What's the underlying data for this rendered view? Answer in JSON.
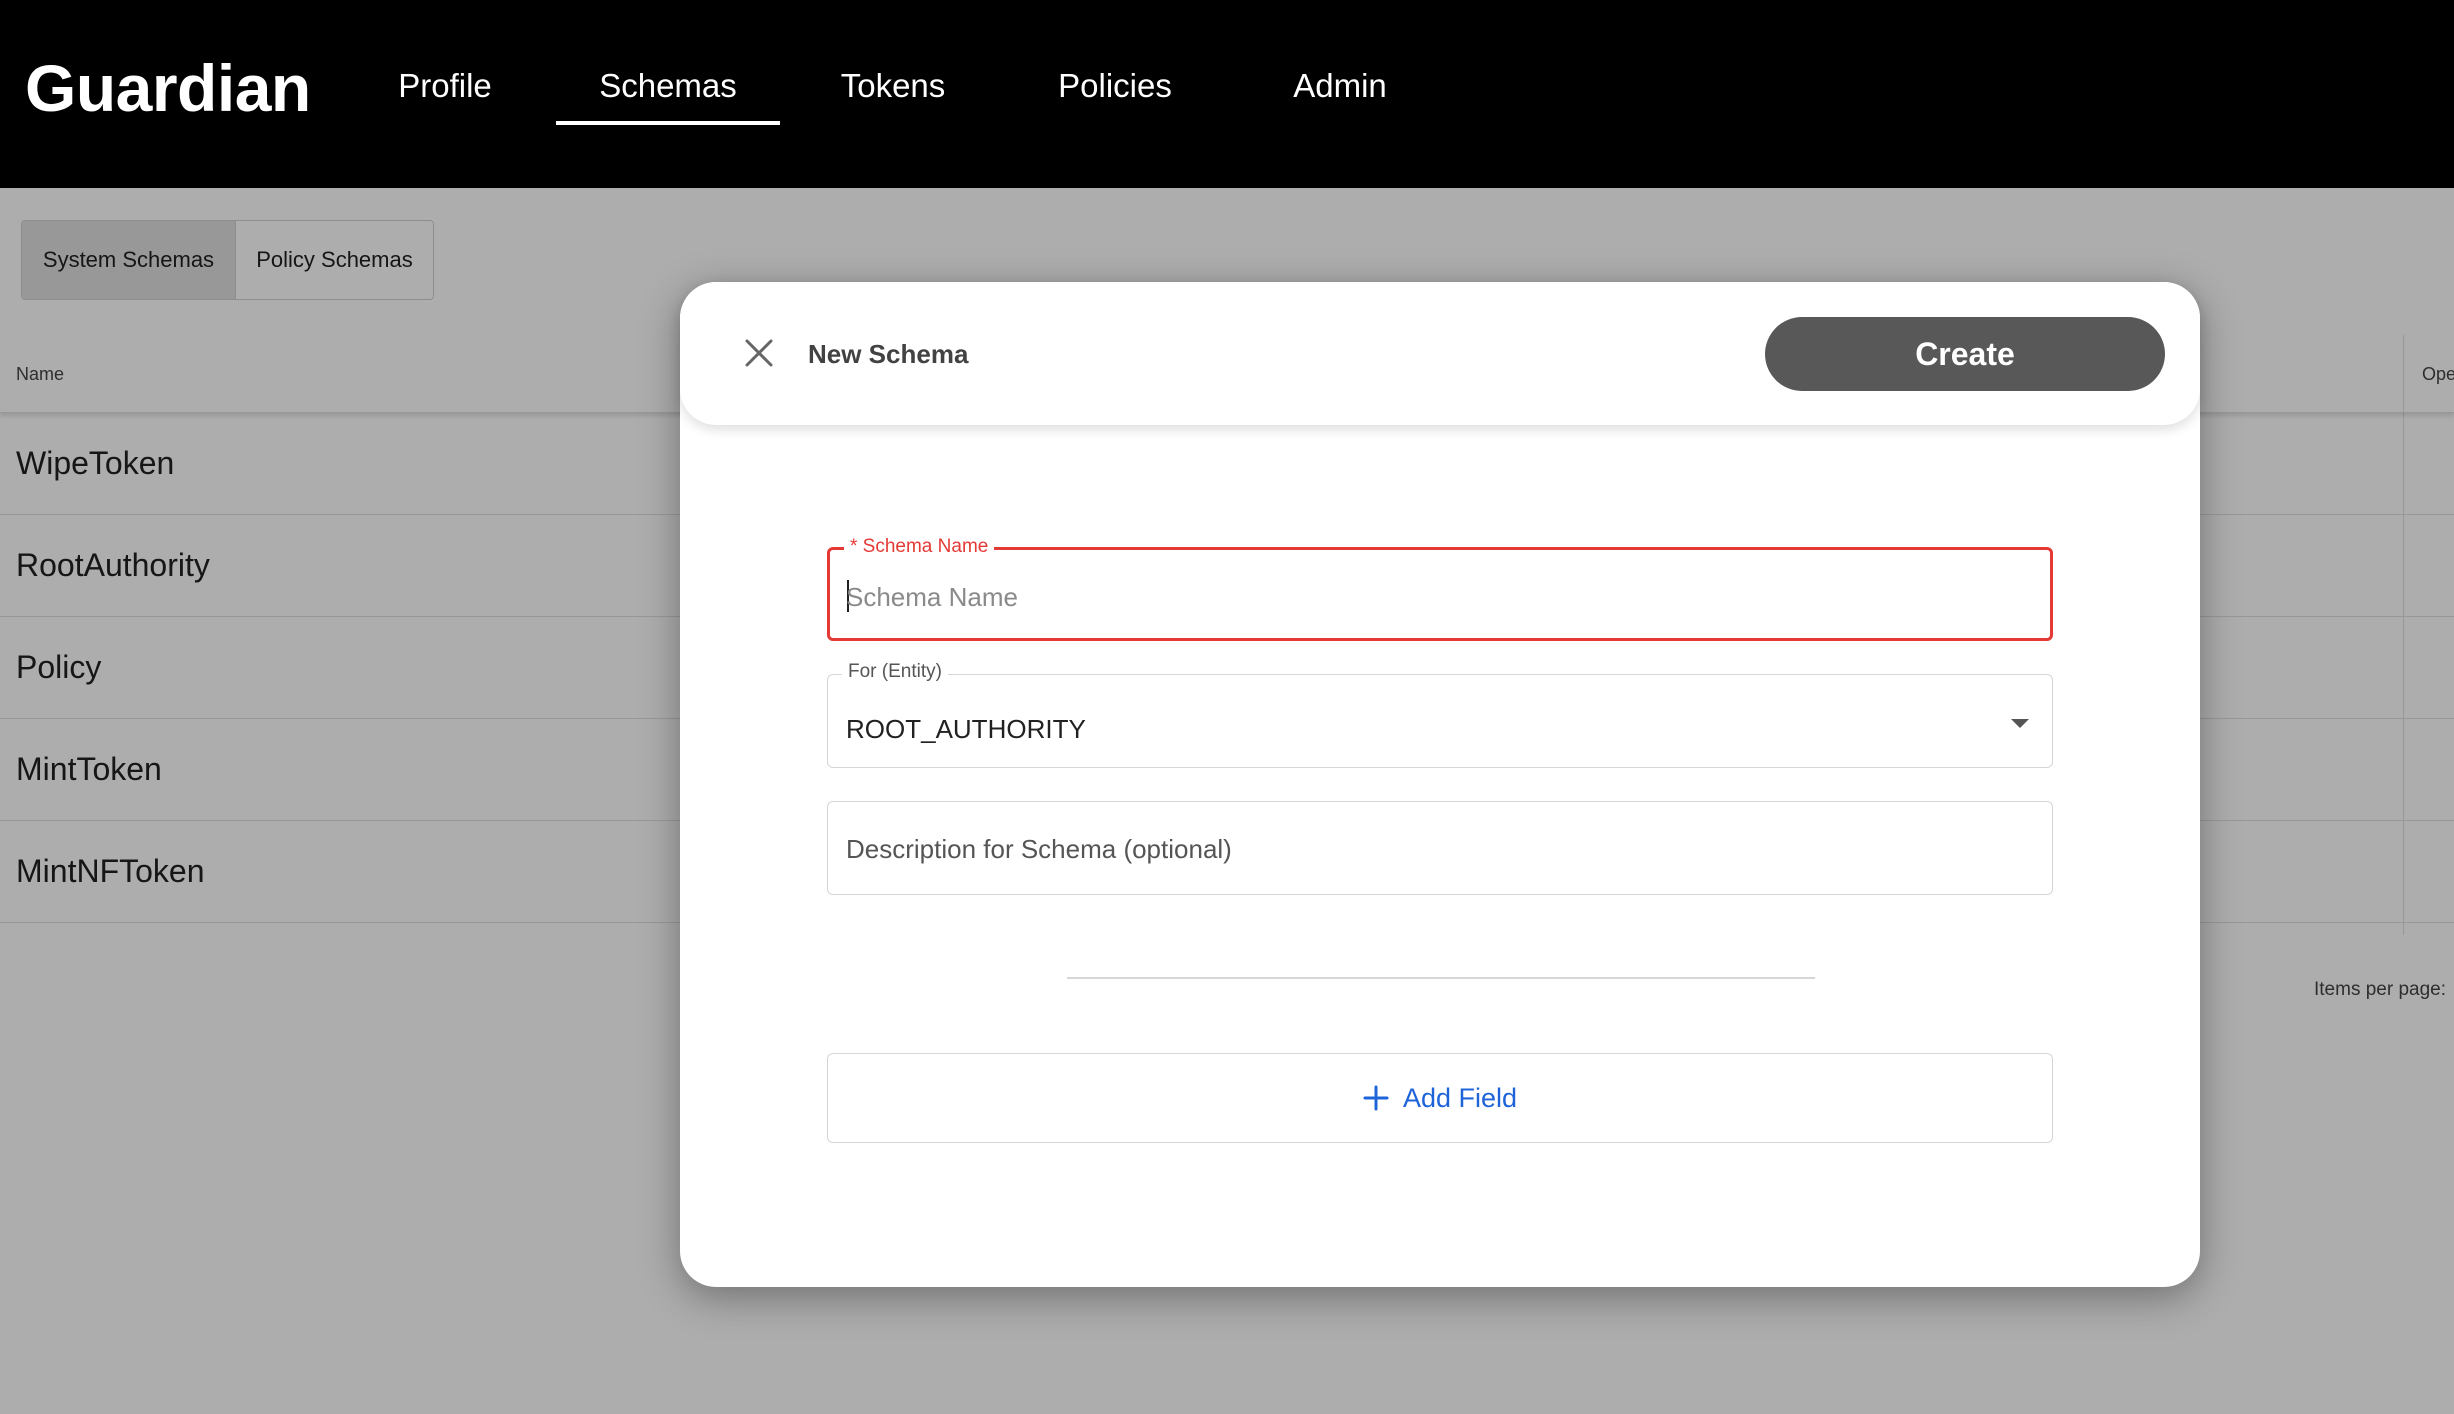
{
  "app": {
    "logo": "Guardian"
  },
  "nav": {
    "items": [
      {
        "label": "Profile"
      },
      {
        "label": "Schemas"
      },
      {
        "label": "Tokens"
      },
      {
        "label": "Policies"
      },
      {
        "label": "Admin"
      }
    ],
    "active": "Schemas"
  },
  "tabs": {
    "system": "System Schemas",
    "policy": "Policy Schemas",
    "active": "System Schemas"
  },
  "table": {
    "columns": {
      "name": "Name",
      "operations": "Ope"
    },
    "rows": [
      {
        "name": "WipeToken"
      },
      {
        "name": "RootAuthority"
      },
      {
        "name": "Policy"
      },
      {
        "name": "MintToken"
      },
      {
        "name": "MintNFToken"
      }
    ],
    "paginator_label": "Items per page:"
  },
  "dialog": {
    "title": "New Schema",
    "create_label": "Create",
    "schema_name": {
      "label": "* Schema Name",
      "placeholder": "Schema Name",
      "value": ""
    },
    "entity": {
      "label": "For (Entity)",
      "value": "ROOT_AUTHORITY"
    },
    "description": {
      "placeholder": "Description for Schema (optional)",
      "value": ""
    },
    "add_field_label": "Add Field"
  },
  "colors": {
    "header_bg": "#000000",
    "create_button": "#585858",
    "error_red": "#e53935",
    "link_blue": "#1e64d8"
  }
}
